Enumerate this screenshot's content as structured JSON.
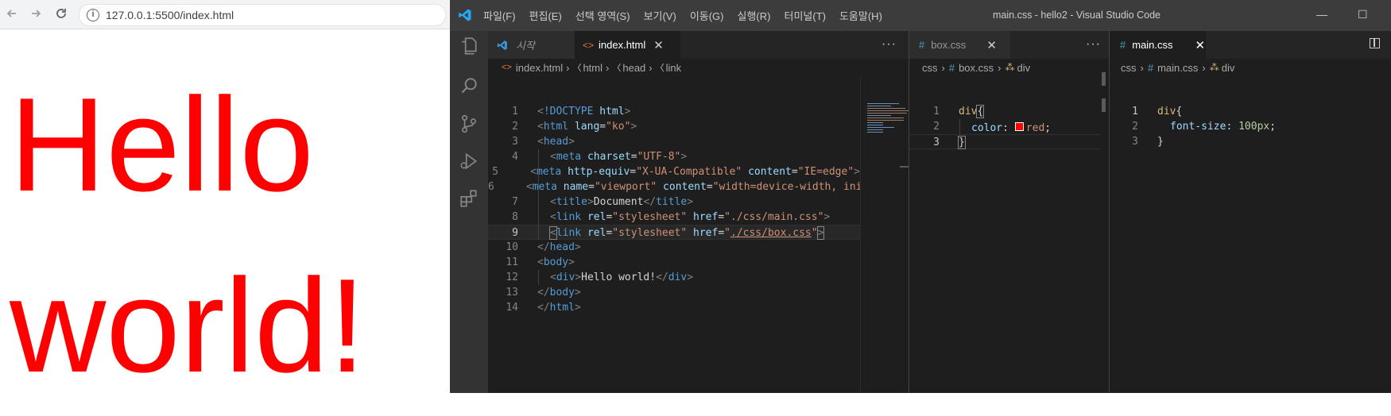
{
  "browser": {
    "url": "127.0.0.1:5500/index.html",
    "content_text": "Hello world!",
    "content_color": "#ff0000"
  },
  "vscode": {
    "menu": [
      "파일(F)",
      "편집(E)",
      "선택 영역(S)",
      "보기(V)",
      "이동(G)",
      "실행(R)",
      "터미널(T)",
      "도움말(H)"
    ],
    "window_title": "main.css - hello2 - Visual Studio Code",
    "group1": {
      "tabs": [
        {
          "label": "시작"
        },
        {
          "label": "index.html"
        }
      ],
      "breadcrumb": [
        "index.html",
        "html",
        "head",
        "link"
      ],
      "line_numbers": [
        "1",
        "2",
        "3",
        "4",
        "5",
        "6",
        "7",
        "8",
        "9",
        "10",
        "11",
        "12",
        "13",
        "14"
      ]
    },
    "group2": {
      "tab_label": "box.css",
      "breadcrumb": [
        "css",
        "box.css",
        "div"
      ],
      "line_numbers": [
        "1",
        "2",
        "3"
      ],
      "code": {
        "selector": "div",
        "property": "color",
        "value": "red",
        "swatch": "#ff0000"
      }
    },
    "group3": {
      "tab_label": "main.css",
      "breadcrumb": [
        "css",
        "main.css",
        "div"
      ],
      "line_numbers": [
        "1",
        "2",
        "3"
      ],
      "code": {
        "selector": "div",
        "property": "font-size",
        "value": "100px"
      }
    }
  }
}
